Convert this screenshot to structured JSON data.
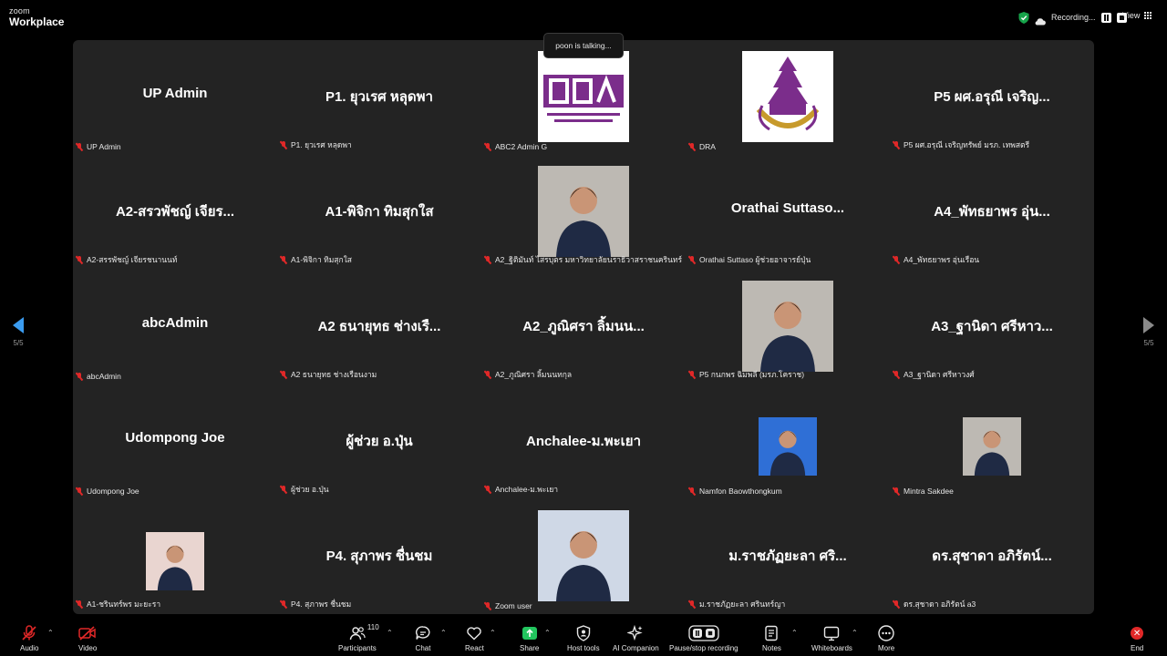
{
  "app": {
    "logo_top": "zoom",
    "logo_bottom": "Workplace"
  },
  "topbar": {
    "recording_text": "Recording...",
    "view_label": "View",
    "status_color": "#16a34a"
  },
  "talking_popup": "poon is talking...",
  "gallery": {
    "page_indicator_left": "5/5",
    "page_indicator_right": "5/5",
    "tiles": [
      {
        "name": "UP  Admin",
        "label": "UP  Admin",
        "muted": true
      },
      {
        "name": "P1. ยุวเรศ  หลุดพา",
        "label": "P1. ยุวเรศ  หลุดพา",
        "muted": true
      },
      {
        "name": "",
        "label": "ABC2 Admin G",
        "muted": true,
        "image": "dra-logo"
      },
      {
        "name": "",
        "label": "DRA",
        "muted": true,
        "image": "university-seal"
      },
      {
        "name": "P5 ผศ.อรุณี เจริญ...",
        "label": "P5 ผศ.อรุณี เจริญทรัพย์ มรภ. เทพสตรี",
        "muted": true
      },
      {
        "name": "A2-สรวพัชญ์ เจียร...",
        "label": "A2-สรรพัชญ์ เจียรชนานนท์",
        "muted": true
      },
      {
        "name": "A1-พิจิกา ทิมสุกใส",
        "label": "A1-พิจิกา ทิมสุกใส",
        "muted": true
      },
      {
        "name": "",
        "label": "A2_ฐิติมันท์  ไสรบุตร มหาวิทยาลัยนราธิวาสราชนครินทร์",
        "muted": true,
        "image": "person-photo"
      },
      {
        "name": "Orathai  Suttaso...",
        "label": "Orathai Suttaso  ผู้ช่วยอาจารย์ปุ่น",
        "muted": true
      },
      {
        "name": "A4_พัทธยาพร อุ่น...",
        "label": "A4_พัทธยาพร อุ่นเรือน",
        "muted": true
      },
      {
        "name": "abcAdmin",
        "label": "abcAdmin",
        "muted": true
      },
      {
        "name": "A2 ธนายุทธ ช่างเรื...",
        "label": "A2 ธนายุทธ ช่างเรือนงาม",
        "muted": true
      },
      {
        "name": "A2_ภูณิศรา ลิ้มนน...",
        "label": "A2_ภูณิศรา ลิ้มนนทกุล",
        "muted": true
      },
      {
        "name": "",
        "label": "P5 กนกพร ฉิมพลี (มรภ.โคราช)",
        "muted": true,
        "image": "person-photo"
      },
      {
        "name": "A3_ฐานิดา ศรีหาว...",
        "label": "A3_ฐานิดา ศรีหาวงศ์",
        "muted": true
      },
      {
        "name": "Udompong Joe",
        "label": "Udompong Joe",
        "muted": true
      },
      {
        "name": "ผู้ช่วย อ.ปุ่น",
        "label": "ผู้ช่วย อ.ปุ่น",
        "muted": true
      },
      {
        "name": "Anchalee-ม.พะเยา",
        "label": "Anchalee-ม.พะเยา",
        "muted": true
      },
      {
        "name": "",
        "label": "Namfon Baowthongkum",
        "muted": true,
        "image": "person-photo"
      },
      {
        "name": "",
        "label": "Mintra Sakdee",
        "muted": true,
        "image": "person-photo"
      },
      {
        "name": "",
        "label": "A1-ชรินทร์พร มะยะรา",
        "muted": true,
        "image": "person-photo"
      },
      {
        "name": "P4. สุภาพร ชื่นชม",
        "label": "P4. สุภาพร ชื่นชม",
        "muted": true
      },
      {
        "name": "",
        "label": "Zoom user",
        "muted": true,
        "image": "person-photo"
      },
      {
        "name": "ม.ราชภัฏยะลา ศริ...",
        "label": "ม.ราชภัฏยะลา ศรินทร์ญา",
        "muted": true
      },
      {
        "name": "ดร.สุชาดา อภิรัตน์...",
        "label": "ดร.สุชาดา อภิรัตน์ a3",
        "muted": true
      }
    ]
  },
  "toolbar": {
    "audio": "Audio",
    "video": "Video",
    "participants": "Participants",
    "participant_count": "110",
    "chat": "Chat",
    "react": "React",
    "share": "Share",
    "host_tools": "Host tools",
    "ai_companion": "AI Companion",
    "pause_stop_recording": "Pause/stop recording",
    "notes": "Notes",
    "whiteboards": "Whiteboards",
    "more": "More",
    "end": "End",
    "share_color": "#22c55e",
    "end_color": "#e02828"
  }
}
